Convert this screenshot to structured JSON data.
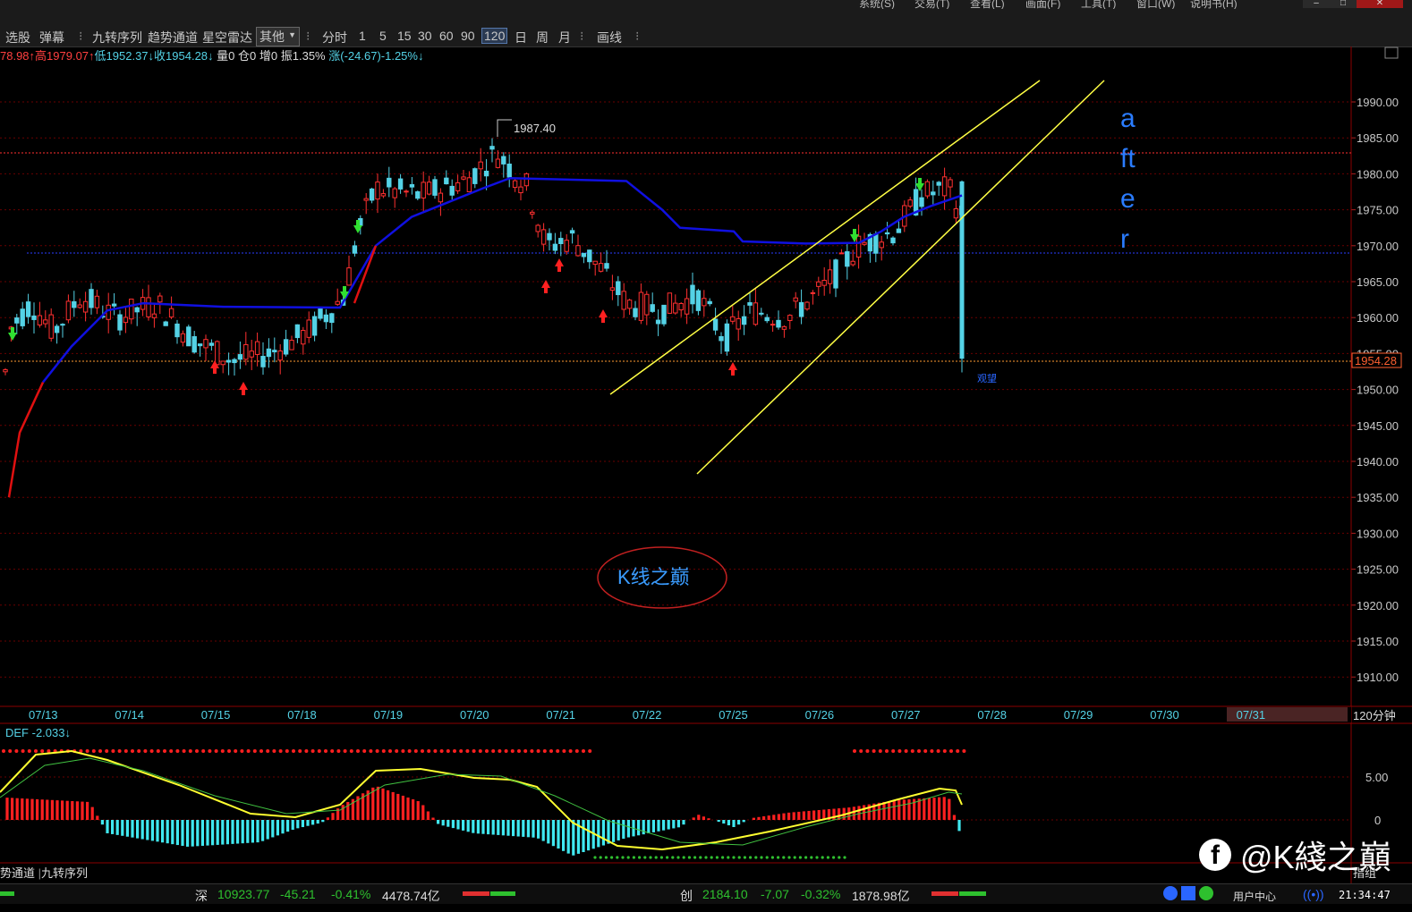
{
  "menu": [
    "系统(S)",
    "交易(T)",
    "查看(L)",
    "画面(F)",
    "工具(T)",
    "窗口(W)",
    "说明书(H)"
  ],
  "toolbar": {
    "left": [
      "选股",
      "弹幕",
      "九转序列",
      "趋势通道",
      "星空雷达"
    ],
    "dropdown": "其他",
    "periods": [
      "分时",
      "1",
      "5",
      "15",
      "30",
      "60",
      "90",
      "120",
      "日",
      "周",
      "月"
    ],
    "selected_period": "120",
    "draw": "画线"
  },
  "quote": {
    "open": "78.98↑",
    "high": "高1979.07↑",
    "low": "低1952.37↓",
    "close": "收1954.28↓",
    "vol": "量0",
    "oi": "仓0",
    "inc": "增0",
    "amp": "振1.35%",
    "chg": "涨(-24.67)-1.25%↓"
  },
  "chart": {
    "y_labels": [
      "1990.00",
      "1985.00",
      "1980.00",
      "1975.00",
      "1970.00",
      "1965.00",
      "1960.00",
      "1955.00",
      "1950.00",
      "1945.00",
      "1940.00",
      "1935.00",
      "1930.00",
      "1925.00",
      "1920.00",
      "1915.00",
      "1910.00"
    ],
    "y_min": 1910,
    "y_max": 1990,
    "last_price": "1954.28",
    "high_label": "1987.40",
    "x_labels": [
      "07/13",
      "07/14",
      "07/15",
      "07/18",
      "07/19",
      "07/20",
      "07/21",
      "07/22",
      "07/25",
      "07/26",
      "07/27",
      "07/28",
      "07/29",
      "07/30",
      "07/31"
    ],
    "period_label": "120分钟",
    "annotation": "a ft e r",
    "annotation_lines": [
      "a",
      "ft",
      "e",
      "r"
    ],
    "small_label": "观望",
    "ellipse_label": "K线之巅"
  },
  "indicator": {
    "name": "DEF -2.033↓",
    "y_labels": [
      "5.00",
      "0"
    ],
    "tabs": [
      "势通道",
      "九转序列"
    ],
    "right_tag": "指组"
  },
  "status": {
    "shen_label": "深",
    "shen_value": "10923.77",
    "shen_chg": "-45.21",
    "shen_pct": "-0.41%",
    "shen_amt": "4478.74亿",
    "chuang_label": "创",
    "chuang_value": "2184.10",
    "chuang_chg": "-7.07",
    "chuang_pct": "-0.32%",
    "chuang_amt": "1878.98亿",
    "user_center": "用户中心",
    "time": "21:34:47"
  },
  "watermark": "@K綫之巔",
  "colors": {
    "up": "#ff3030",
    "down": "#54d2e6",
    "ma": "#1010e0",
    "channel": "#ffff44",
    "grid": "#8b0000"
  }
}
